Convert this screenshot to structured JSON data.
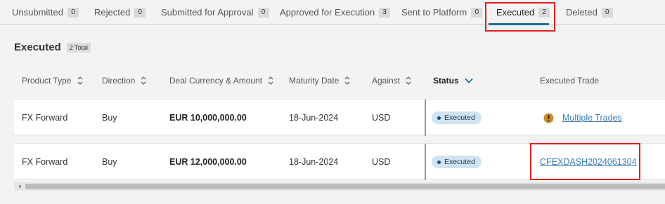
{
  "tabs": [
    {
      "label": "Unsubmitted",
      "count": "0"
    },
    {
      "label": "Rejected",
      "count": "0"
    },
    {
      "label": "Submitted for Approval",
      "count": "0"
    },
    {
      "label": "Approved for Execution",
      "count": "3"
    },
    {
      "label": "Sent to Platform",
      "count": "0"
    },
    {
      "label": "Executed",
      "count": "2",
      "active": true
    },
    {
      "label": "Deleted",
      "count": "0"
    }
  ],
  "section": {
    "title": "Executed",
    "total": "2 Total"
  },
  "columns": {
    "product_type": "Product Type",
    "direction": "Direction",
    "deal_currency_amount": "Deal Currency & Amount",
    "maturity_date": "Maturity Date",
    "against": "Against",
    "status": "Status",
    "executed_trade": "Executed Trade"
  },
  "rows": [
    {
      "product_type": "FX Forward",
      "direction": "Buy",
      "amount": "EUR 10,000,000.00",
      "maturity": "18-Jun-2024",
      "against": "USD",
      "status": "Executed",
      "executed_trade": "Multiple Trades",
      "warning_icon": "exclamation-circle-icon"
    },
    {
      "product_type": "FX Forward",
      "direction": "Buy",
      "amount": "EUR 12,000,000.00",
      "maturity": "18-Jun-2024",
      "against": "USD",
      "status": "Executed",
      "executed_trade": "CFEXDASH2024061304"
    }
  ],
  "colors": {
    "accent": "#1f6e94",
    "link": "#3b7bb8",
    "status_pill": "#cfe3f0",
    "warning": "#c9892a",
    "highlight": "#e0201b"
  }
}
